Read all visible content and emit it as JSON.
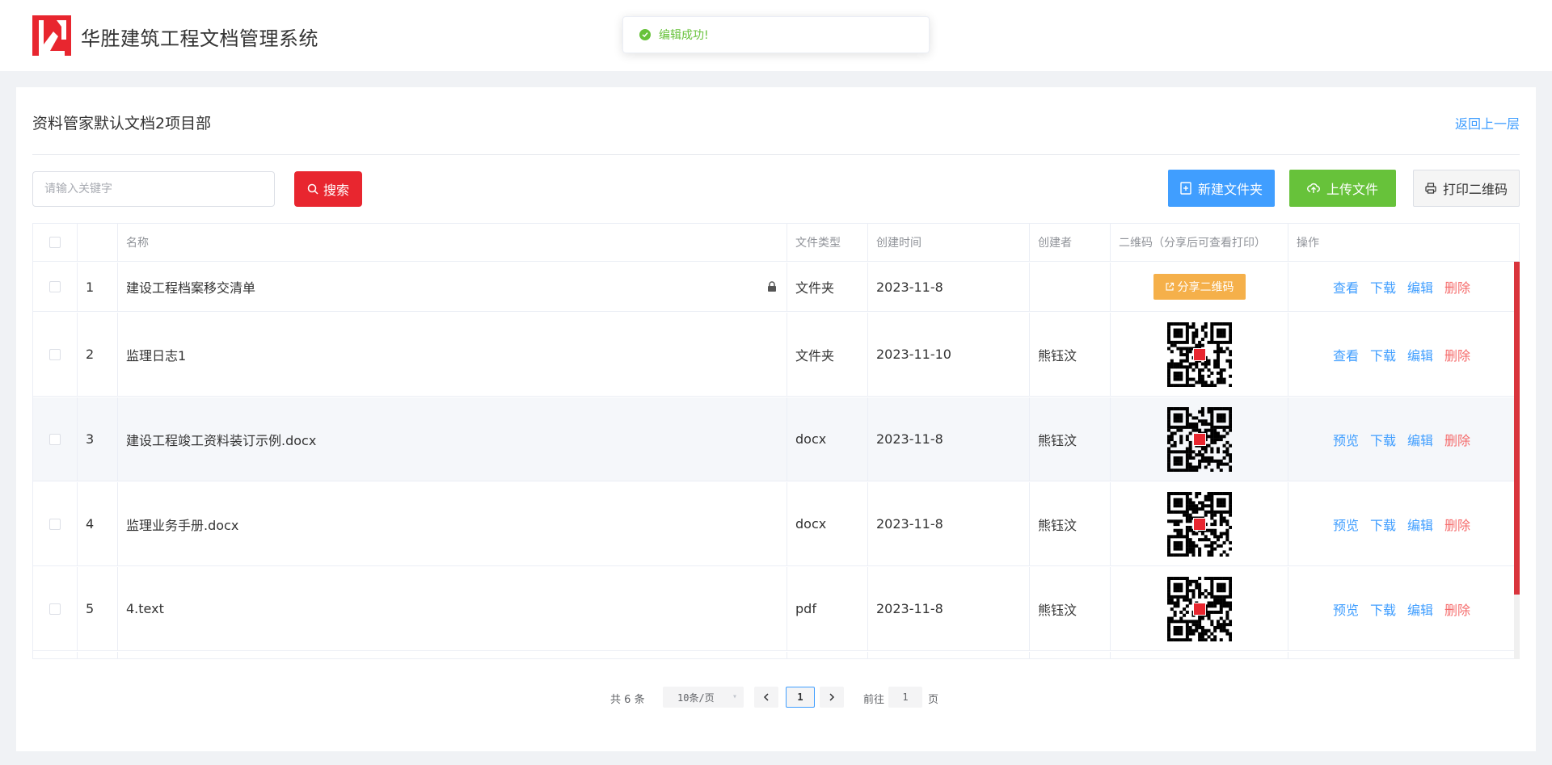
{
  "app": {
    "title": "华胜建筑工程文档管理系统",
    "brand_color": "#e8262f"
  },
  "toast": {
    "message": "编辑成功!",
    "type": "success"
  },
  "page": {
    "title": "资料管家默认文档2项目部",
    "back_label": "返回上一层"
  },
  "search": {
    "placeholder": "请输入关键字",
    "value": "",
    "button_label": "搜索"
  },
  "toolbar": {
    "new_folder_label": "新建文件夹",
    "upload_label": "上传文件",
    "print_qr_label": "打印二维码"
  },
  "table": {
    "columns": [
      "名称",
      "文件类型",
      "创建时间",
      "创建者",
      "二维码（分享后可查看打印）",
      "操作"
    ],
    "rows": [
      {
        "index": "1",
        "name": "建设工程档案移交清单",
        "type": "文件夹",
        "created": "2023-11-8",
        "creator": "",
        "locked": true,
        "qr": "share-button",
        "share_label": "分享二维码",
        "actions": [
          "查看",
          "下载",
          "编辑",
          "删除"
        ]
      },
      {
        "index": "2",
        "name": "监理日志1",
        "type": "文件夹",
        "created": "2023-11-10",
        "creator": "熊钰汶",
        "qr": "qr-code",
        "actions": [
          "查看",
          "下载",
          "编辑",
          "删除"
        ]
      },
      {
        "index": "3",
        "name": "建设工程竣工资料装订示例.docx",
        "type": "docx",
        "created": "2023-11-8",
        "creator": "熊钰汶",
        "qr": "qr-code",
        "actions": [
          "预览",
          "下载",
          "编辑",
          "删除"
        ]
      },
      {
        "index": "4",
        "name": "监理业务手册.docx",
        "type": "docx",
        "created": "2023-11-8",
        "creator": "熊钰汶",
        "qr": "qr-code",
        "actions": [
          "预览",
          "下载",
          "编辑",
          "删除"
        ]
      },
      {
        "index": "5",
        "name": "4.text",
        "type": "pdf",
        "created": "2023-11-8",
        "creator": "熊钰汶",
        "qr": "qr-code",
        "actions": [
          "预览",
          "下载",
          "编辑",
          "删除"
        ]
      }
    ]
  },
  "pagination": {
    "total_prefix": "共",
    "total": "6",
    "total_suffix": "条",
    "page_size": "10条/页",
    "current_page": "1",
    "goto_label": "前往",
    "goto_value": "1",
    "page_suffix": "页"
  }
}
